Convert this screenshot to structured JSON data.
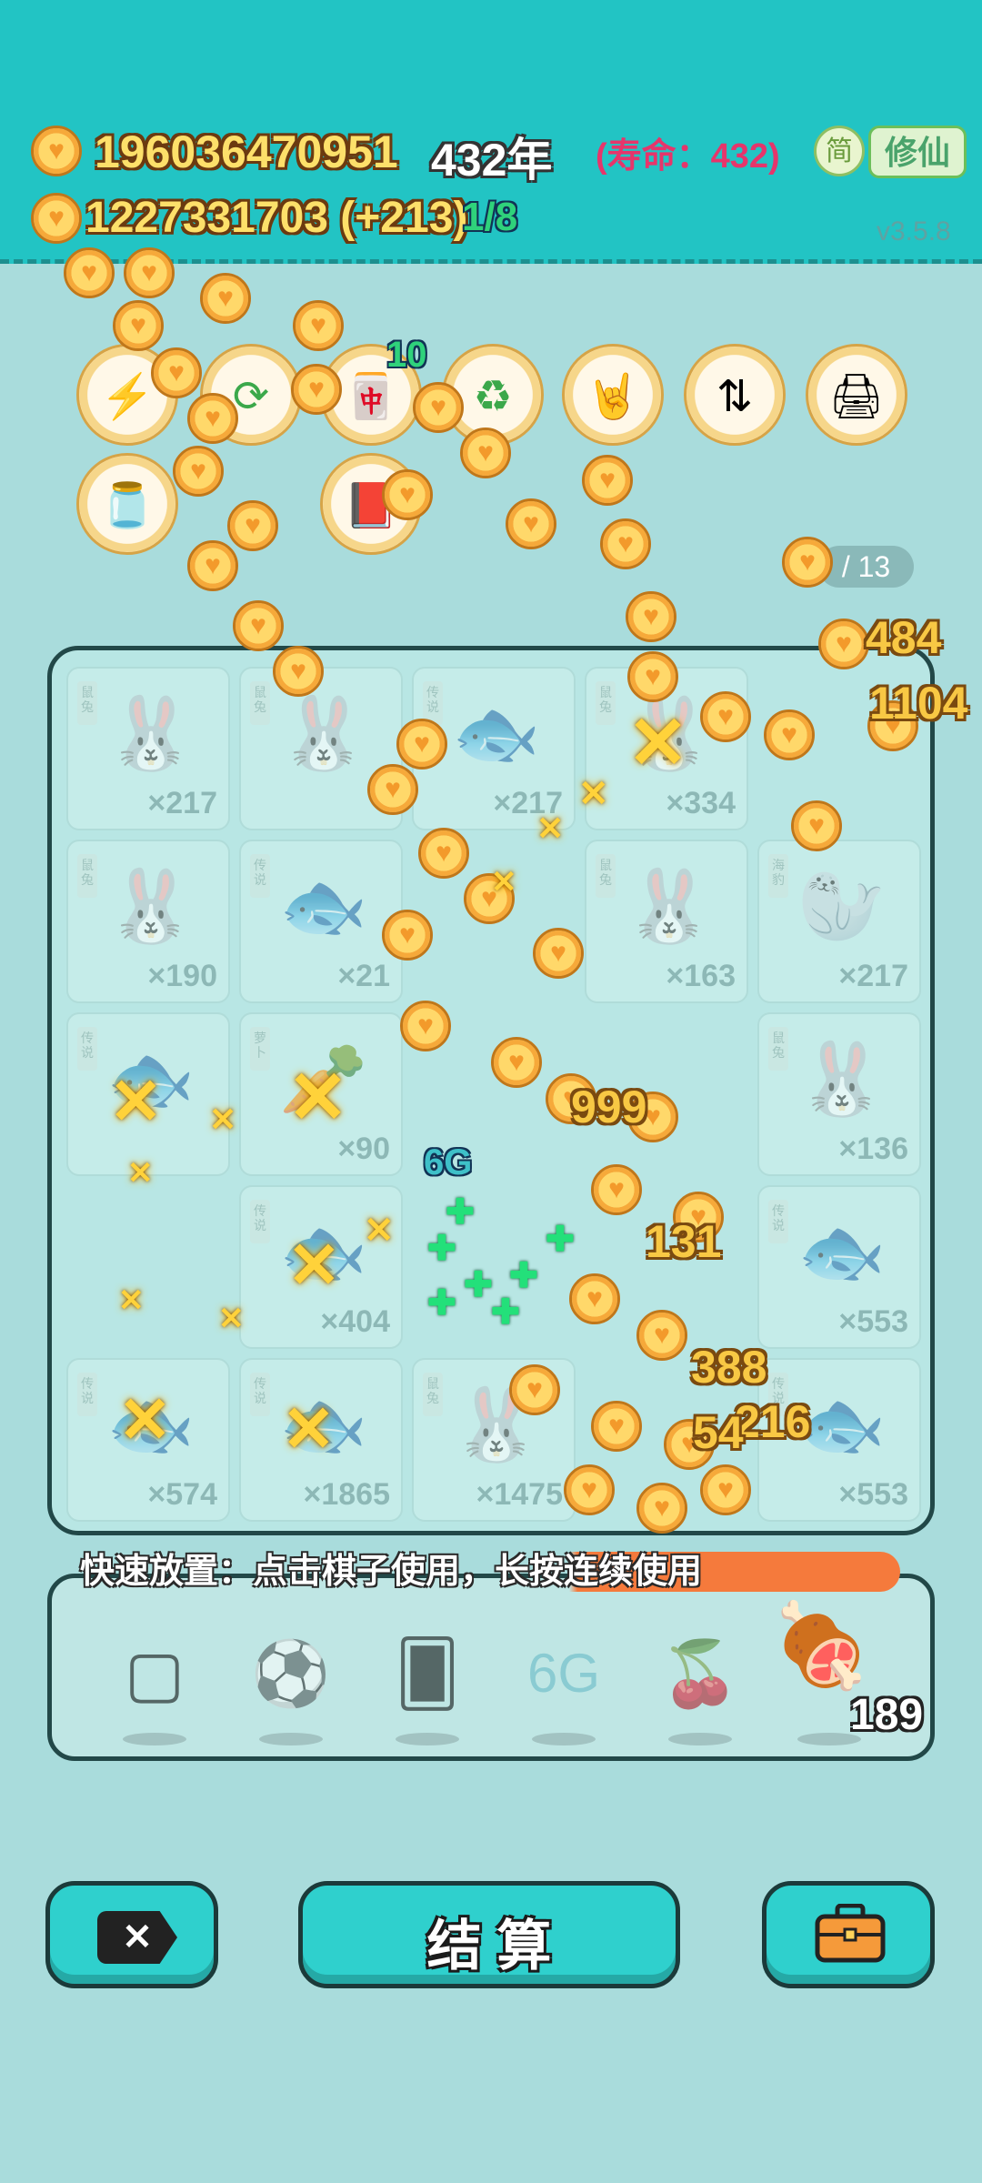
{
  "header": {
    "coins": "196036470951",
    "year": "432年",
    "lifespan": "(寿命：432)",
    "lang_button": "简",
    "cultivate_button": "修仙",
    "sub_coins": "1227331703 (+213)",
    "sub_progress": "1/8",
    "version": "v3.5.8"
  },
  "tools": [
    {
      "icon": "lightning-icon"
    },
    {
      "icon": "refresh-icon"
    },
    {
      "icon": "fan-icon",
      "count": "10"
    },
    {
      "icon": "recycle-icon"
    },
    {
      "icon": "rock-hand-icon"
    },
    {
      "icon": "swap-bowls-icon"
    },
    {
      "icon": "printer-icon"
    },
    {
      "icon": "jar-icon"
    },
    {
      "icon": "time-book-icon"
    }
  ],
  "tool_page": "/ 13",
  "board": {
    "cells": [
      {
        "item": "rabbit",
        "count": "×217"
      },
      {
        "item": "rabbit",
        "count": ""
      },
      {
        "item": "koi",
        "count": "×217"
      },
      {
        "item": "rabbit",
        "count": "×334"
      },
      {
        "item": "rabbit",
        "count": "×190"
      },
      {
        "item": "koi",
        "count": "×21"
      },
      {
        "item": "rabbit",
        "count": "×163"
      },
      {
        "item": "seal",
        "count": "×217"
      },
      {
        "item": "koi",
        "count": ""
      },
      {
        "item": "carrot",
        "count": "×90"
      },
      {
        "item": "rabbit",
        "count": "×136"
      },
      {
        "item": "koi",
        "count": "×404"
      },
      {
        "item": "koi",
        "count": "×553"
      },
      {
        "item": "koi",
        "count": "×574"
      },
      {
        "item": "koi",
        "count": "×1865"
      },
      {
        "item": "rabbit",
        "count": "×1475"
      },
      {
        "item": "koi",
        "count": "×553"
      }
    ]
  },
  "floating_numbers": [
    "484",
    "1104",
    "999",
    "131",
    "388",
    "216",
    "54"
  ],
  "badge_6g": "6G",
  "quick_place_tip": "快速放置：点击棋子使用，长按连续使用",
  "tray": {
    "items": [
      "frame-icon",
      "ball-icon",
      "cards-icon",
      "6g-icon",
      "lychee-icon",
      "ham-icon"
    ],
    "count": "189"
  },
  "buttons": {
    "settle": "结 算"
  },
  "colors": {
    "teal": "#22c4c4",
    "board_bg": "#b8e6e4",
    "coin_gold": "#fde06a",
    "lifespan_red": "#e6356b",
    "progress_green": "#2fd27b",
    "tip_orange": "#f57a3c"
  }
}
